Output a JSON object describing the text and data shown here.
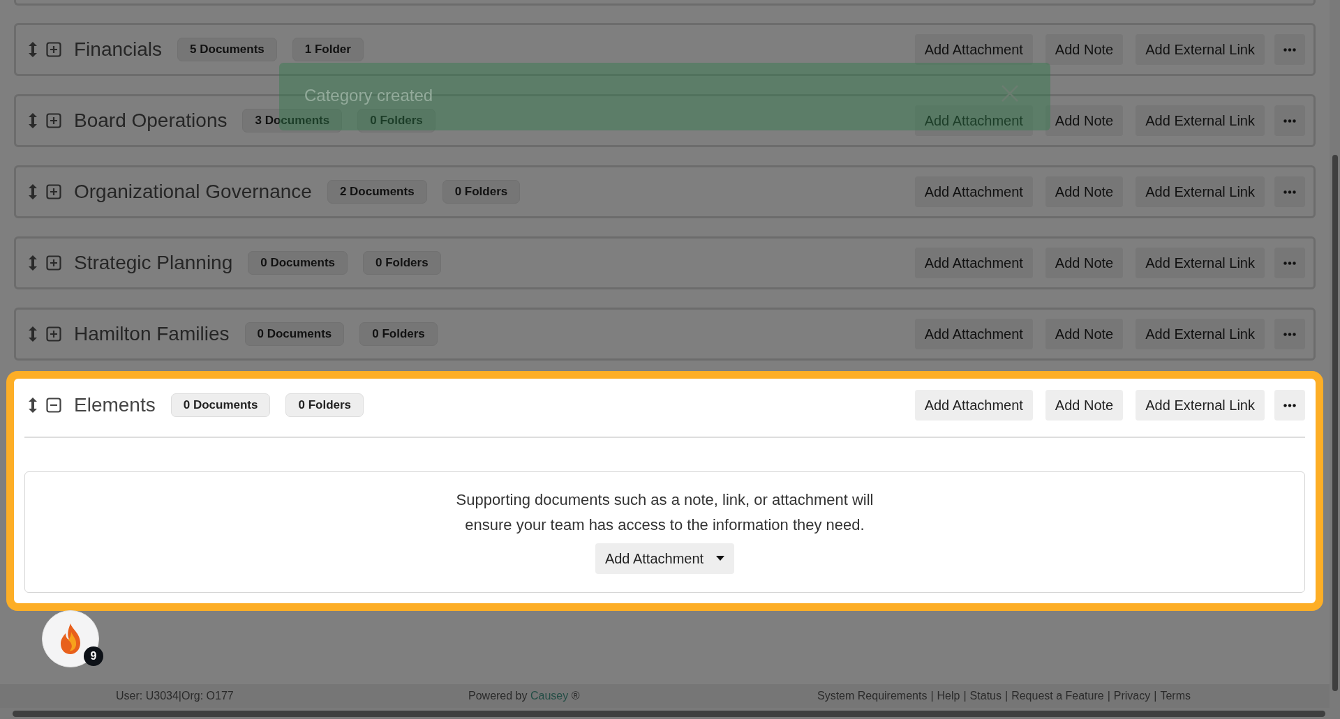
{
  "categories": [
    {
      "title": "Financials",
      "documents": "5 Documents",
      "folders": "1 Folder",
      "expanded": false,
      "highlighted": false,
      "actions": [
        "Add Attachment",
        "Add Note",
        "Add External Link"
      ]
    },
    {
      "title": "Board Operations",
      "documents": "3 Documents",
      "folders": "0 Folders",
      "expanded": false,
      "highlighted": false,
      "actions": [
        "Add Attachment",
        "Add Note",
        "Add External Link"
      ]
    },
    {
      "title": "Organizational Governance",
      "documents": "2 Documents",
      "folders": "0 Folders",
      "expanded": false,
      "highlighted": false,
      "actions": [
        "Add Attachment",
        "Add Note",
        "Add External Link"
      ]
    },
    {
      "title": "Strategic Planning",
      "documents": "0 Documents",
      "folders": "0 Folders",
      "expanded": false,
      "highlighted": false,
      "actions": [
        "Add Attachment",
        "Add Note",
        "Add External Link"
      ]
    },
    {
      "title": "Hamilton Families",
      "documents": "0 Documents",
      "folders": "0 Folders",
      "expanded": false,
      "highlighted": false,
      "actions": [
        "Add Attachment",
        "Add Note",
        "Add External Link"
      ]
    },
    {
      "title": "Elements",
      "documents": "0 Documents",
      "folders": "0 Folders",
      "expanded": true,
      "highlighted": true,
      "actions": [
        "Add Attachment",
        "Add Note",
        "Add External Link"
      ],
      "empty_message": "Supporting documents such as a note, link, or attachment will ensure your team has access to the information they need.",
      "empty_action": "Add Attachment"
    }
  ],
  "toast": {
    "message": "Category created"
  },
  "notification_widget": {
    "badge": "9"
  },
  "footer": {
    "user": "User: U3034|Org: O177",
    "powered_by": "Powered by",
    "brand": "Causey",
    "brand_mark": "®",
    "separator": "|",
    "links": [
      "System Requirements",
      "Help",
      "Status",
      "Request a Feature",
      "Privacy",
      "Terms"
    ]
  }
}
